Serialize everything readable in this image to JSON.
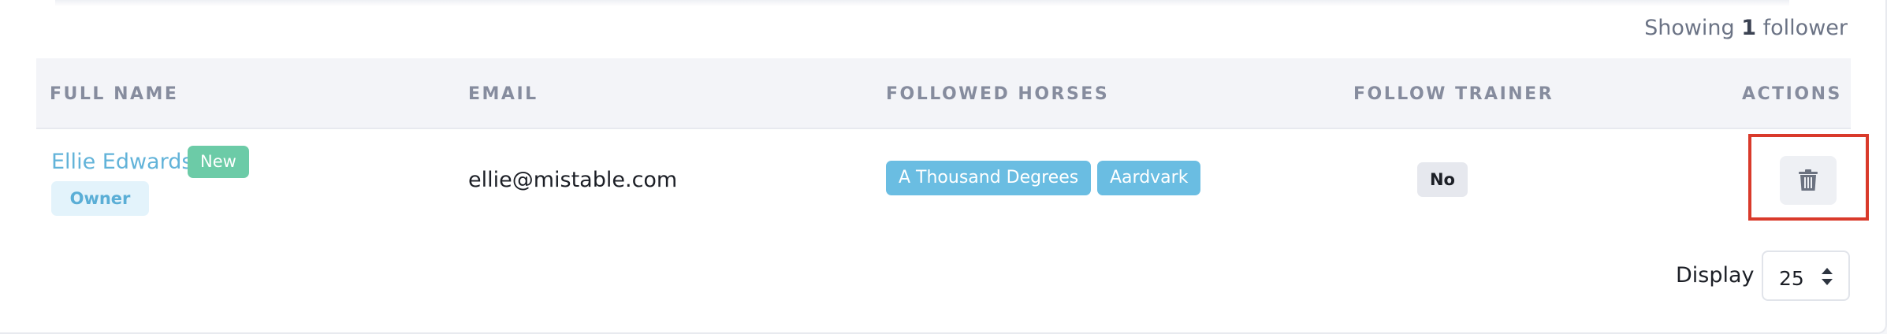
{
  "summary": {
    "prefix": "Showing",
    "count": "1",
    "suffix": "follower"
  },
  "table": {
    "columns": [
      "FULL NAME",
      "EMAIL",
      "FOLLOWED HORSES",
      "FOLLOW TRAINER",
      "ACTIONS"
    ],
    "rows": [
      {
        "full_name": "Ellie Edwards",
        "new_badge": "New",
        "role_badge": "Owner",
        "email": "ellie@mistable.com",
        "followed_horses": [
          "A Thousand Degrees",
          "Aardvark"
        ],
        "follow_trainer": "No",
        "actions": [
          "trash-icon"
        ]
      }
    ]
  },
  "pagination": {
    "display_label": "Display",
    "page_size": "25"
  },
  "colors": {
    "link": "#62b3d9",
    "new_badge": "#6ccba7",
    "horse_tag": "#6abde2",
    "highlight": "#d93a2b"
  }
}
